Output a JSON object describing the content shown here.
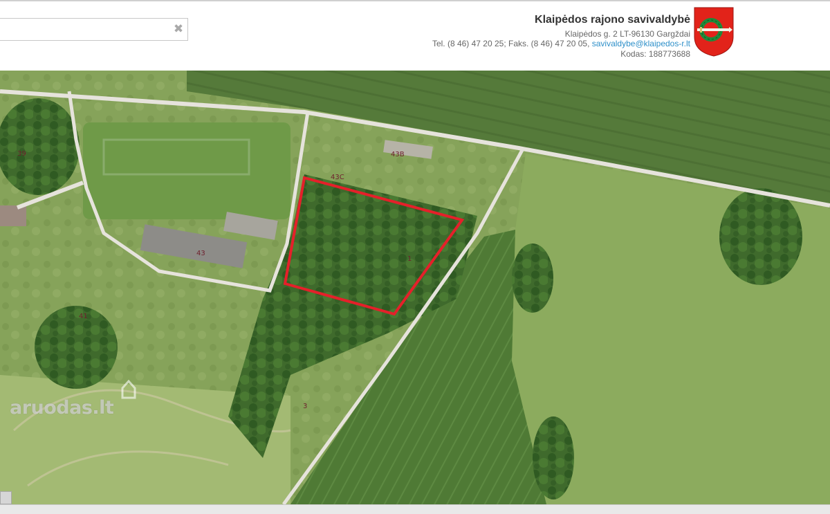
{
  "search": {
    "value": "",
    "placeholder": "",
    "clear_glyph": "✖"
  },
  "municipality": {
    "title": "Klaipėdos rajono savivaldybė",
    "address": "Klaipėdos g. 2 LT-96130 Gargždai",
    "phone_fax": "Tel. (8 46) 47 20 25; Faks. (8 46) 47 20 05, ",
    "email": "savivaldybe@klaipedos-r.lt",
    "code": "Kodas: 188773688",
    "coat_icon": "coat-of-arms-icon"
  },
  "map": {
    "parcel_labels": {
      "p39": "39",
      "p43B": "43B",
      "p43C": "43C",
      "p43": "43",
      "p41": "41",
      "p1": "1",
      "p3": "3"
    },
    "highlight_color": "#e5202a"
  },
  "watermark": {
    "text": "aruodas.lt"
  }
}
